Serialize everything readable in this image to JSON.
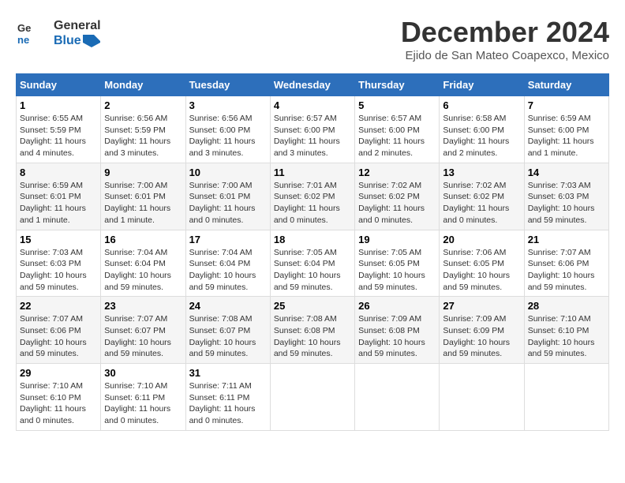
{
  "logo": {
    "line1": "General",
    "line2": "Blue"
  },
  "title": "December 2024",
  "location": "Ejido de San Mateo Coapexco, Mexico",
  "days_of_week": [
    "Sunday",
    "Monday",
    "Tuesday",
    "Wednesday",
    "Thursday",
    "Friday",
    "Saturday"
  ],
  "weeks": [
    [
      {
        "day": "1",
        "sunrise": "6:55 AM",
        "sunset": "5:59 PM",
        "daylight": "11 hours and 4 minutes."
      },
      {
        "day": "2",
        "sunrise": "6:56 AM",
        "sunset": "5:59 PM",
        "daylight": "11 hours and 3 minutes."
      },
      {
        "day": "3",
        "sunrise": "6:56 AM",
        "sunset": "6:00 PM",
        "daylight": "11 hours and 3 minutes."
      },
      {
        "day": "4",
        "sunrise": "6:57 AM",
        "sunset": "6:00 PM",
        "daylight": "11 hours and 3 minutes."
      },
      {
        "day": "5",
        "sunrise": "6:57 AM",
        "sunset": "6:00 PM",
        "daylight": "11 hours and 2 minutes."
      },
      {
        "day": "6",
        "sunrise": "6:58 AM",
        "sunset": "6:00 PM",
        "daylight": "11 hours and 2 minutes."
      },
      {
        "day": "7",
        "sunrise": "6:59 AM",
        "sunset": "6:00 PM",
        "daylight": "11 hours and 1 minute."
      }
    ],
    [
      {
        "day": "8",
        "sunrise": "6:59 AM",
        "sunset": "6:01 PM",
        "daylight": "11 hours and 1 minute."
      },
      {
        "day": "9",
        "sunrise": "7:00 AM",
        "sunset": "6:01 PM",
        "daylight": "11 hours and 1 minute."
      },
      {
        "day": "10",
        "sunrise": "7:00 AM",
        "sunset": "6:01 PM",
        "daylight": "11 hours and 0 minutes."
      },
      {
        "day": "11",
        "sunrise": "7:01 AM",
        "sunset": "6:02 PM",
        "daylight": "11 hours and 0 minutes."
      },
      {
        "day": "12",
        "sunrise": "7:02 AM",
        "sunset": "6:02 PM",
        "daylight": "11 hours and 0 minutes."
      },
      {
        "day": "13",
        "sunrise": "7:02 AM",
        "sunset": "6:02 PM",
        "daylight": "11 hours and 0 minutes."
      },
      {
        "day": "14",
        "sunrise": "7:03 AM",
        "sunset": "6:03 PM",
        "daylight": "10 hours and 59 minutes."
      }
    ],
    [
      {
        "day": "15",
        "sunrise": "7:03 AM",
        "sunset": "6:03 PM",
        "daylight": "10 hours and 59 minutes."
      },
      {
        "day": "16",
        "sunrise": "7:04 AM",
        "sunset": "6:04 PM",
        "daylight": "10 hours and 59 minutes."
      },
      {
        "day": "17",
        "sunrise": "7:04 AM",
        "sunset": "6:04 PM",
        "daylight": "10 hours and 59 minutes."
      },
      {
        "day": "18",
        "sunrise": "7:05 AM",
        "sunset": "6:04 PM",
        "daylight": "10 hours and 59 minutes."
      },
      {
        "day": "19",
        "sunrise": "7:05 AM",
        "sunset": "6:05 PM",
        "daylight": "10 hours and 59 minutes."
      },
      {
        "day": "20",
        "sunrise": "7:06 AM",
        "sunset": "6:05 PM",
        "daylight": "10 hours and 59 minutes."
      },
      {
        "day": "21",
        "sunrise": "7:07 AM",
        "sunset": "6:06 PM",
        "daylight": "10 hours and 59 minutes."
      }
    ],
    [
      {
        "day": "22",
        "sunrise": "7:07 AM",
        "sunset": "6:06 PM",
        "daylight": "10 hours and 59 minutes."
      },
      {
        "day": "23",
        "sunrise": "7:07 AM",
        "sunset": "6:07 PM",
        "daylight": "10 hours and 59 minutes."
      },
      {
        "day": "24",
        "sunrise": "7:08 AM",
        "sunset": "6:07 PM",
        "daylight": "10 hours and 59 minutes."
      },
      {
        "day": "25",
        "sunrise": "7:08 AM",
        "sunset": "6:08 PM",
        "daylight": "10 hours and 59 minutes."
      },
      {
        "day": "26",
        "sunrise": "7:09 AM",
        "sunset": "6:08 PM",
        "daylight": "10 hours and 59 minutes."
      },
      {
        "day": "27",
        "sunrise": "7:09 AM",
        "sunset": "6:09 PM",
        "daylight": "10 hours and 59 minutes."
      },
      {
        "day": "28",
        "sunrise": "7:10 AM",
        "sunset": "6:10 PM",
        "daylight": "10 hours and 59 minutes."
      }
    ],
    [
      {
        "day": "29",
        "sunrise": "7:10 AM",
        "sunset": "6:10 PM",
        "daylight": "11 hours and 0 minutes."
      },
      {
        "day": "30",
        "sunrise": "7:10 AM",
        "sunset": "6:11 PM",
        "daylight": "11 hours and 0 minutes."
      },
      {
        "day": "31",
        "sunrise": "7:11 AM",
        "sunset": "6:11 PM",
        "daylight": "11 hours and 0 minutes."
      },
      null,
      null,
      null,
      null
    ]
  ]
}
